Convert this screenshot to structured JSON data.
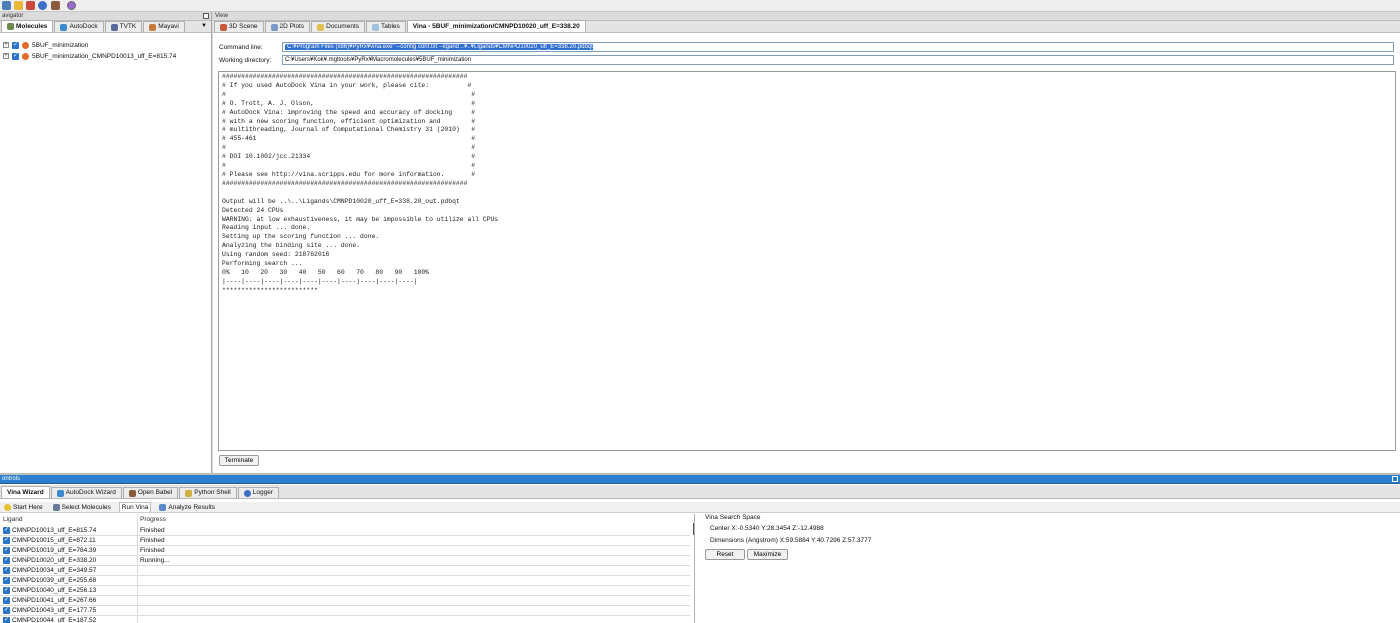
{
  "toolbar": {
    "icons": [
      "pyrx-icon",
      "open-icon",
      "save-icon",
      "help-icon",
      "settings-icon",
      "about-icon"
    ]
  },
  "navigator": {
    "title": "avigator",
    "tabs": [
      {
        "label": "Molecules",
        "icon": "molecule-icon"
      },
      {
        "label": "AutoDock",
        "icon": "autodock-icon"
      },
      {
        "label": "TVTK",
        "icon": "tvtk-icon"
      },
      {
        "label": "Mayavi",
        "icon": "mayavi-icon"
      }
    ],
    "tree": [
      {
        "label": "5BUF_minimization"
      },
      {
        "label": "5BUF_minimization_CMNPD10013_uff_E=815.74"
      }
    ]
  },
  "view": {
    "title": "View",
    "tabs": [
      {
        "label": "3D Scene",
        "icon": "scene-icon"
      },
      {
        "label": "2D Plots",
        "icon": "plot-icon"
      },
      {
        "label": "Documents",
        "icon": "document-icon"
      },
      {
        "label": "Tables",
        "icon": "table-icon"
      },
      {
        "label": "Vina - 5BUF_minimization/CMNPD10020_uff_E=338.20",
        "icon": ""
      }
    ],
    "command_line_label": "Command line:",
    "command_line_value": "\"C:¥Program Files (x86)¥PyRx¥vina.exe\" --config conf.txt --ligand ..¥..¥Ligands¥CMNPD10020_uff_E=338.20.pdbqt",
    "working_dir_label": "Working directory:",
    "working_dir_value": "C:¥Users¥Kok¥.mgltools¥PyRx¥Macromolecules¥5BUF_minimization",
    "console": "################################################################\n# If you used AutoDock Vina in your work, please cite:          #\n#                                                                #\n# O. Trott, A. J. Olson,                                         #\n# AutoDock Vina: improving the speed and accuracy of docking     #\n# with a new scoring function, efficient optimization and        #\n# multithreading, Journal of Computational Chemistry 31 (2010)   #\n# 455-461                                                        #\n#                                                                #\n# DOI 10.1002/jcc.21334                                          #\n#                                                                #\n# Please see http://vina.scripps.edu for more information.       #\n################################################################\n\nOutput will be ..\\..\\Ligands\\CMNPD10020_uff_E=338.20_out.pdbqt\nDetected 24 CPUs\nWARNING: at low exhaustiveness, it may be impossible to utilize all CPUs\nReading input ... done.\nSetting up the scoring function ... done.\nAnalyzing the binding site ... done.\nUsing random seed: 218762016\nPerforming search ...\n0%   10   20   30   40   50   60   70   80   90   100%\n|----|----|----|----|----|----|----|----|----|----|\n*************************",
    "terminate_label": "Terminate"
  },
  "controls": {
    "title": "ontrols",
    "tabs": [
      {
        "label": "Vina Wizard",
        "icon": ""
      },
      {
        "label": "AutoDock Wizard",
        "icon": "wizard-icon"
      },
      {
        "label": "Open Babel",
        "icon": "babel-icon"
      },
      {
        "label": "Python Shell",
        "icon": "python-icon"
      },
      {
        "label": "Logger",
        "icon": "logger-icon"
      }
    ],
    "subtabs": [
      {
        "label": "Start Here",
        "icon": "bulb-icon"
      },
      {
        "label": "Select Molecules",
        "icon": "select-icon"
      },
      {
        "label": "Run Vina",
        "icon": ""
      },
      {
        "label": "Analyze Results",
        "icon": "analyze-icon"
      }
    ],
    "table": {
      "headers": [
        "Ligand",
        "Progress"
      ],
      "rows": [
        {
          "ligand": "CMNPD10013_uff_E=815.74",
          "progress": "Finished"
        },
        {
          "ligand": "CMNPD10015_uff_E=872.11",
          "progress": "Finished"
        },
        {
          "ligand": "CMNPD10019_uff_E=784.39",
          "progress": "Finished"
        },
        {
          "ligand": "CMNPD10020_uff_E=338.20",
          "progress": "Running..."
        },
        {
          "ligand": "CMNPD10034_uff_E=349.57",
          "progress": ""
        },
        {
          "ligand": "CMNPD10039_uff_E=255.68",
          "progress": ""
        },
        {
          "ligand": "CMNPD10040_uff_E=256.13",
          "progress": ""
        },
        {
          "ligand": "CMNPD10041_uff_E=267.66",
          "progress": ""
        },
        {
          "ligand": "CMNPD10043_uff_E=177.75",
          "progress": ""
        },
        {
          "ligand": "CMNPD10044_uff_E=187.52",
          "progress": ""
        }
      ]
    },
    "search_space": {
      "title": "Vina Search Space",
      "center": "Center  X:-0.5340   Y:28.3454  Z:-12.4988",
      "dimensions": "Dimensions (Angstrom) X:59.5884    Y:40.7296    Z:57.3777",
      "reset_label": "Reset",
      "maximize_label": "Maximize"
    }
  }
}
